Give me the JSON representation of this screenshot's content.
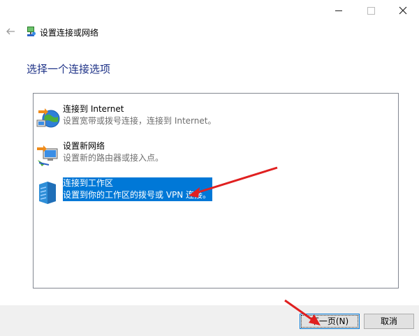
{
  "window": {
    "minimize_icon": "minimize-icon",
    "maximize_icon": "maximize-icon",
    "close_icon": "close-icon"
  },
  "header": {
    "back_icon": "back-arrow-icon",
    "title": "设置连接或网络"
  },
  "heading": "选择一个连接选项",
  "options": [
    {
      "title": "连接到 Internet",
      "desc": "设置宽带或拨号连接，连接到 Internet。",
      "icon": "globe-network-icon",
      "selected": false
    },
    {
      "title": "设置新网络",
      "desc": "设置新的路由器或接入点。",
      "icon": "new-network-icon",
      "selected": false
    },
    {
      "title": "连接到工作区",
      "desc": "设置到你的工作区的拨号或 VPN 连接。",
      "icon": "workplace-icon",
      "selected": true
    }
  ],
  "buttons": {
    "next": "下一页(N)",
    "cancel": "取消"
  },
  "colors": {
    "accent": "#0078d7",
    "heading": "#1e3287",
    "annotation_arrow": "#e02020"
  }
}
